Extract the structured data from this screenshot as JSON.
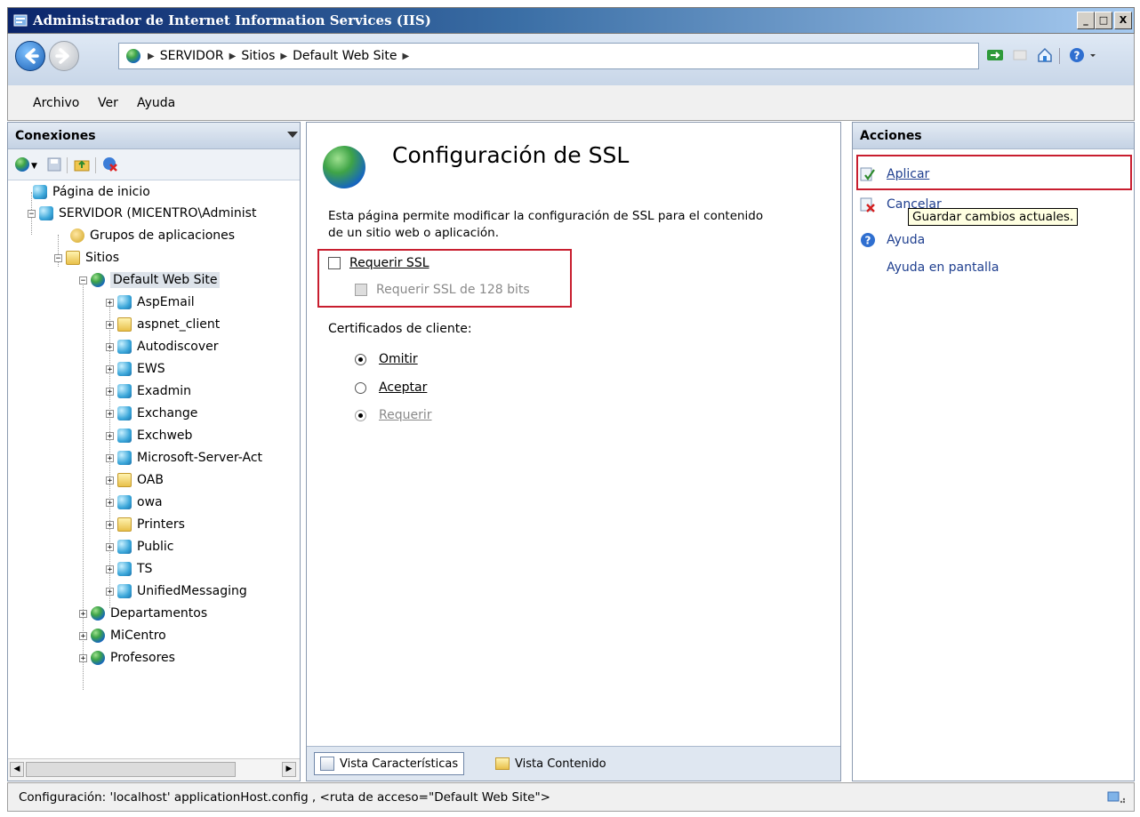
{
  "window": {
    "title": "Administrador de Internet Information Services (IIS)",
    "buttons": {
      "minimize": "_",
      "maximize": "□",
      "close": "X"
    }
  },
  "address": {
    "crumbs": [
      "SERVIDOR",
      "Sitios",
      "Default Web Site"
    ]
  },
  "menu": [
    "Archivo",
    "Ver",
    "Ayuda"
  ],
  "connections": {
    "header": "Conexiones",
    "tree": {
      "home": "Página de inicio",
      "server": "SERVIDOR (MICENTRO\\Administ",
      "app_pools": "Grupos de aplicaciones",
      "sites": "Sitios",
      "default_site": "Default Web Site",
      "children": [
        "AspEmail",
        "aspnet_client",
        "Autodiscover",
        "EWS",
        "Exadmin",
        "Exchange",
        "Exchweb",
        "Microsoft-Server-Act",
        "OAB",
        "owa",
        "Printers",
        "Public",
        "TS",
        "UnifiedMessaging"
      ],
      "other_sites": [
        "Departamentos",
        "MiCentro",
        "Profesores"
      ]
    }
  },
  "main": {
    "title": "Configuración de SSL",
    "description_line1": "Esta página permite modificar la configuración de SSL para el contenido",
    "description_line2": "de un sitio web o aplicación.",
    "require_ssl": "Requerir SSL",
    "require_128": "Requerir SSL de 128 bits",
    "client_certs_label": "Certificados de cliente:",
    "radio_ignore": "Omitir",
    "radio_accept": "Aceptar",
    "radio_require": "Requerir",
    "tabs": {
      "features": "Vista Características",
      "content": "Vista Contenido"
    }
  },
  "actions": {
    "header": "Acciones",
    "apply": "Aplicar",
    "cancel": "Cancelar",
    "tooltip": "Guardar cambios actuales.",
    "help": "Ayuda",
    "online_help": "Ayuda en pantalla"
  },
  "status": {
    "text": "Configuración: 'localhost' applicationHost.config , <ruta de acceso=\"Default Web Site\">"
  },
  "colors": {
    "highlight_box": "#c81e2f",
    "link": "#1f3f8f"
  }
}
